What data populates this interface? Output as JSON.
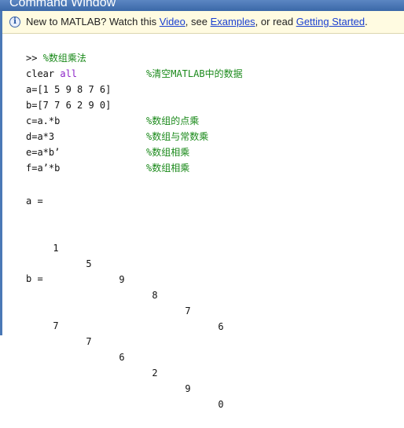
{
  "window": {
    "title": "Command Window"
  },
  "info_bar": {
    "icon": "info-icon",
    "prefix": "New to MATLAB? Watch this ",
    "link_video": "Video",
    "sep1": ", see ",
    "link_examples": "Examples",
    "sep2": ", or read ",
    "link_started": "Getting Started",
    "suffix": "."
  },
  "console": {
    "prompt_line": {
      "prompt": ">> ",
      "comment": "%数组乘法"
    },
    "code_lines": [
      {
        "code": "clear ",
        "keyword": "all",
        "comment": "%清空MATLAB中的数据"
      },
      {
        "code": "a=[1 5 9 8 7 6]",
        "keyword": "",
        "comment": ""
      },
      {
        "code": "b=[7 7 6 2 9 0]",
        "keyword": "",
        "comment": ""
      },
      {
        "code": "c=a.*b",
        "keyword": "",
        "comment": "%数组的点乘"
      },
      {
        "code": "d=a*3",
        "keyword": "",
        "comment": "%数组与常数乘"
      },
      {
        "code": "e=a*b’",
        "keyword": "",
        "comment": "%数组相乘"
      },
      {
        "code": "f=a’*b",
        "keyword": "",
        "comment": "%数组相乘"
      }
    ],
    "outputs": [
      {
        "label": "a =",
        "values": [
          "1",
          "5",
          "9",
          "8",
          "7",
          "6"
        ]
      },
      {
        "label": "b =",
        "values": [
          "7",
          "7",
          "6",
          "2",
          "9",
          "0"
        ]
      }
    ]
  }
}
